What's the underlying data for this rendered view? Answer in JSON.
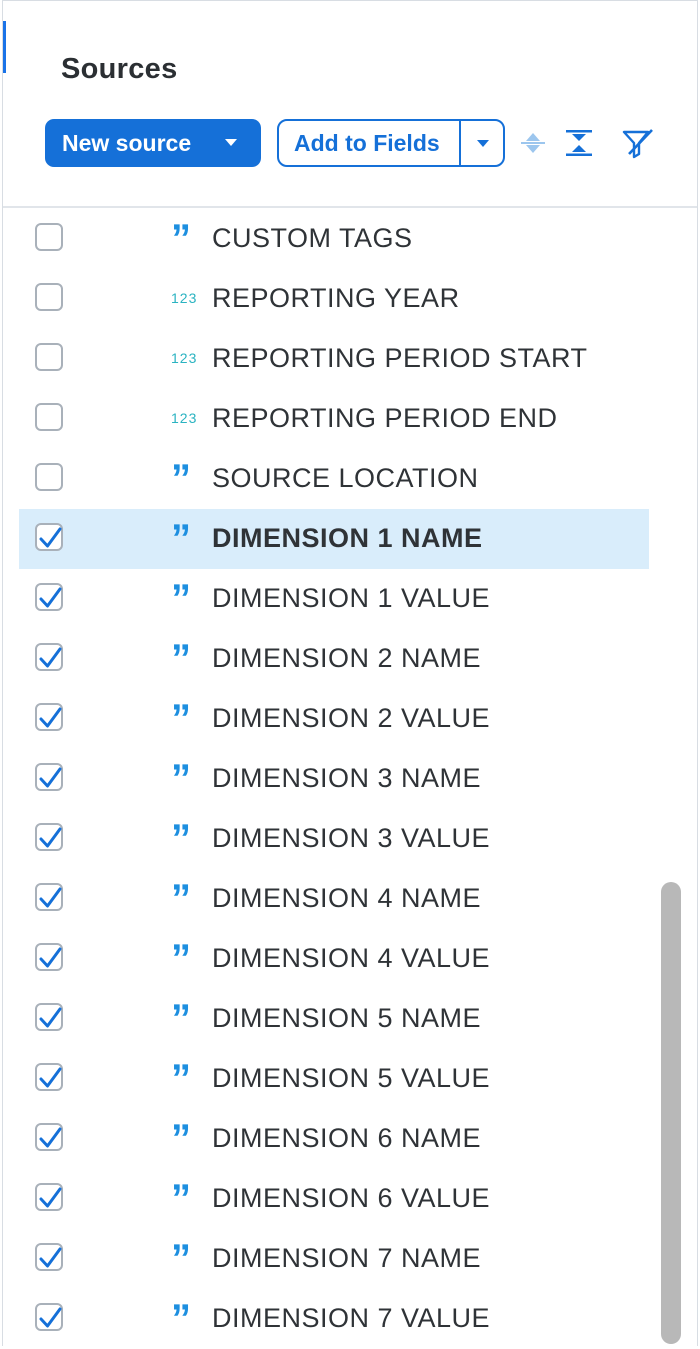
{
  "panel": {
    "title": "Sources"
  },
  "toolbar": {
    "new_source_label": "New source",
    "add_to_fields_label": "Add to Fields",
    "icons": [
      "sort-icon",
      "collapse-icon",
      "clear-filter-icon"
    ]
  },
  "colors": {
    "primary": "#1570d8",
    "selected_row_bg": "#d9edfb",
    "text_type_icon": "#1d8fe0",
    "number_type_icon": "#2ab3c1"
  },
  "fields": [
    {
      "type": "text",
      "label": "CUSTOM TAGS",
      "checked": false
    },
    {
      "type": "number",
      "label": "REPORTING YEAR",
      "checked": false
    },
    {
      "type": "number",
      "label": "REPORTING PERIOD START",
      "checked": false
    },
    {
      "type": "number",
      "label": "REPORTING PERIOD END",
      "checked": false
    },
    {
      "type": "text",
      "label": "SOURCE LOCATION",
      "checked": false
    },
    {
      "type": "text",
      "label": "DIMENSION 1 NAME",
      "checked": true,
      "selected": true
    },
    {
      "type": "text",
      "label": "DIMENSION 1 VALUE",
      "checked": true
    },
    {
      "type": "text",
      "label": "DIMENSION 2 NAME",
      "checked": true
    },
    {
      "type": "text",
      "label": "DIMENSION 2 VALUE",
      "checked": true
    },
    {
      "type": "text",
      "label": "DIMENSION 3 NAME",
      "checked": true
    },
    {
      "type": "text",
      "label": "DIMENSION 3 VALUE",
      "checked": true
    },
    {
      "type": "text",
      "label": "DIMENSION 4 NAME",
      "checked": true
    },
    {
      "type": "text",
      "label": "DIMENSION 4 VALUE",
      "checked": true
    },
    {
      "type": "text",
      "label": "DIMENSION 5 NAME",
      "checked": true
    },
    {
      "type": "text",
      "label": "DIMENSION 5 VALUE",
      "checked": true
    },
    {
      "type": "text",
      "label": "DIMENSION 6 NAME",
      "checked": true
    },
    {
      "type": "text",
      "label": "DIMENSION 6 VALUE",
      "checked": true
    },
    {
      "type": "text",
      "label": "DIMENSION 7 NAME",
      "checked": true
    },
    {
      "type": "text",
      "label": "DIMENSION 7 VALUE",
      "checked": true
    }
  ],
  "type_icons": {
    "text": "”",
    "number": "123"
  }
}
